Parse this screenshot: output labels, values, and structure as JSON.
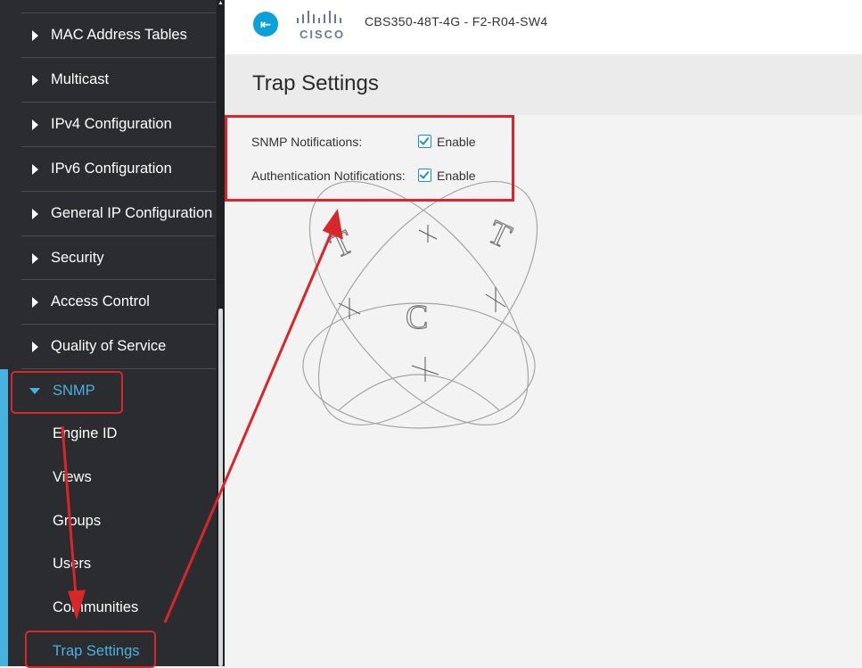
{
  "sidebar": {
    "items": [
      {
        "label": "MAC Address Tables"
      },
      {
        "label": "Multicast"
      },
      {
        "label": "IPv4 Configuration"
      },
      {
        "label": "IPv6 Configuration"
      },
      {
        "label": "General IP Configuration"
      },
      {
        "label": "Security"
      },
      {
        "label": "Access Control"
      },
      {
        "label": "Quality of Service"
      },
      {
        "label": "SNMP"
      }
    ],
    "snmp_children": [
      {
        "label": "Engine ID"
      },
      {
        "label": "Views"
      },
      {
        "label": "Groups"
      },
      {
        "label": "Users"
      },
      {
        "label": "Communities"
      },
      {
        "label": "Trap Settings"
      }
    ],
    "accent_color": "#47b2e0"
  },
  "header": {
    "logo_text": "CISCO",
    "device_name": "CBS350-48T-4G - F2-R04-SW4",
    "toggle_icon": "collapse-menu-icon"
  },
  "page": {
    "title": "Trap Settings",
    "fields": [
      {
        "label": "SNMP Notifications:",
        "checkbox_label": "Enable",
        "checked": true
      },
      {
        "label": "Authentication Notifications:",
        "checkbox_label": "Enable",
        "checked": true
      }
    ]
  },
  "watermark": {
    "letters": [
      "T",
      "T",
      "C"
    ]
  },
  "colors": {
    "annotation_red": "#d8262b",
    "checkbox_blue": "#1a8fd4",
    "header_button": "#0aa0d8"
  }
}
